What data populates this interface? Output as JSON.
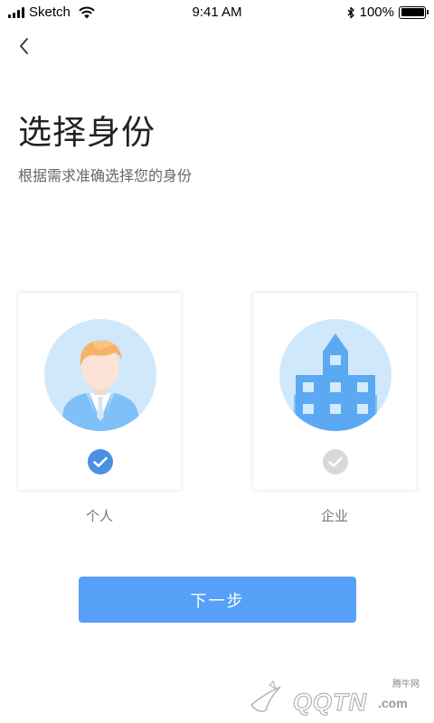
{
  "status_bar": {
    "carrier": "Sketch",
    "time": "9:41 AM",
    "battery": "100%",
    "battery_level": 1.0
  },
  "page": {
    "title": "选择身份",
    "subtitle": "根据需求准确选择您的身份"
  },
  "options": [
    {
      "label": "个人",
      "selected": true,
      "icon": "person-avatar-icon"
    },
    {
      "label": "企业",
      "selected": false,
      "icon": "building-icon"
    }
  ],
  "actions": {
    "next_label": "下一步"
  },
  "colors": {
    "accent": "#56a0f8",
    "avatar_bg": "#cfe8fb",
    "unselected_check": "#d8d8d8"
  },
  "watermark": {
    "small_text": "腾牛网",
    "brand_text": "QQTN",
    "domain_suffix": ".com"
  }
}
